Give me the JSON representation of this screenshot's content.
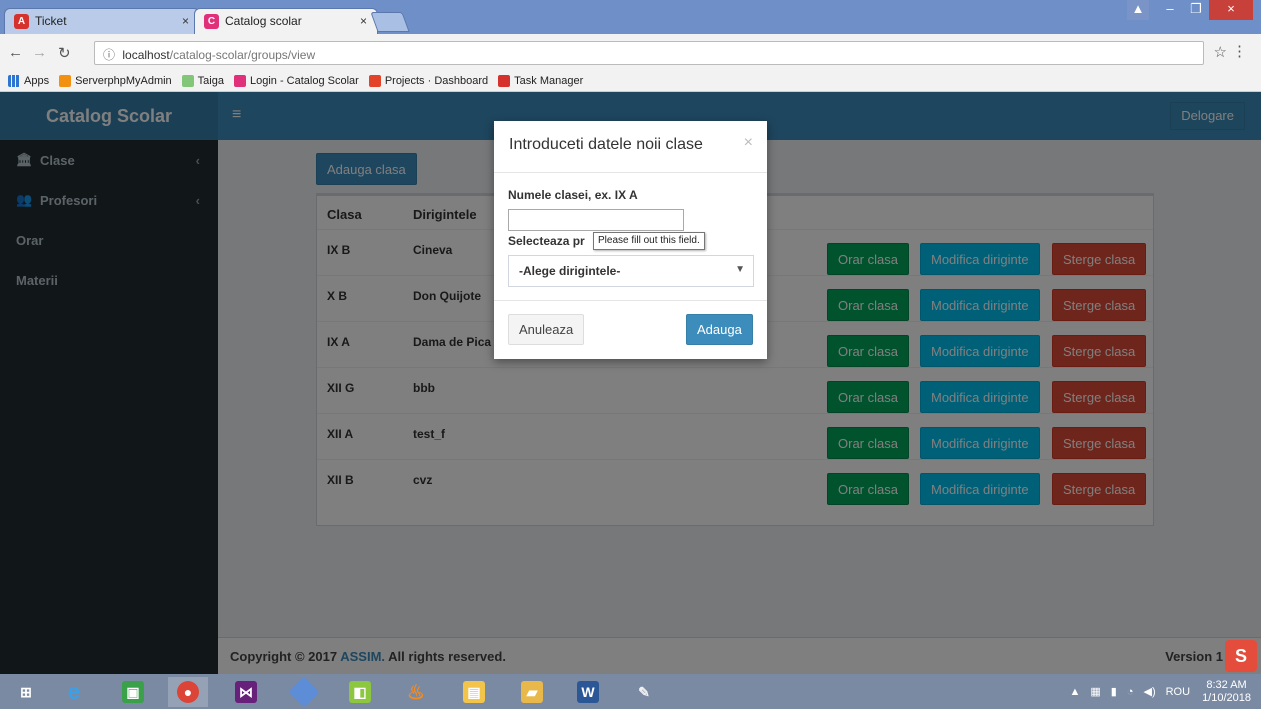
{
  "browser": {
    "tabs": [
      {
        "label": "Ticket",
        "icon": "angular-icon",
        "active": false
      },
      {
        "label": "Catalog scolar",
        "icon": "app-icon",
        "active": true
      }
    ],
    "url_host": "localhost",
    "url_path": "/catalog-scolar/groups/view",
    "bookmarks": [
      {
        "label": "Apps",
        "icon": "apps-grid-icon"
      },
      {
        "label": "ServerphpMyAdmin",
        "icon": "phpmyadmin-icon"
      },
      {
        "label": "Taiga",
        "icon": "taiga-icon"
      },
      {
        "label": "Login - Catalog Scolar",
        "icon": "app-icon"
      },
      {
        "label": "Projects · Dashboard",
        "icon": "gitlab-icon"
      },
      {
        "label": "Task Manager",
        "icon": "angular-icon"
      }
    ]
  },
  "app": {
    "brand": "Catalog Scolar",
    "logout_label": "Delogare",
    "sidebar": [
      {
        "label": "Clase",
        "icon": "bank-icon",
        "has_children": true
      },
      {
        "label": "Profesori",
        "icon": "users-icon",
        "has_children": true
      },
      {
        "label": "Orar",
        "icon": "",
        "has_children": false
      },
      {
        "label": "Materii",
        "icon": "",
        "has_children": false
      }
    ],
    "add_class_label": "Adauga clasa",
    "table": {
      "headers": [
        "Clasa",
        "Dirigintele"
      ],
      "rows": [
        {
          "clasa": "IX B",
          "diriginte": "Cineva"
        },
        {
          "clasa": "X B",
          "diriginte": "Don Quijote"
        },
        {
          "clasa": "IX A",
          "diriginte": "Dama de Pica"
        },
        {
          "clasa": "XII G",
          "diriginte": "bbb"
        },
        {
          "clasa": "XII A",
          "diriginte": "test_f"
        },
        {
          "clasa": "XII B",
          "diriginte": "cvz"
        }
      ],
      "row_actions": {
        "schedule": "Orar clasa",
        "edit": "Modifica diriginte",
        "delete": "Sterge clasa"
      }
    },
    "footer": {
      "prefix": "Copyright © 2017 ",
      "link": "ASSIM.",
      "suffix": " All rights reserved.",
      "version": "Version 1"
    }
  },
  "modal": {
    "title": "Introduceti datele noii clase",
    "close_glyph": "×",
    "name_label": "Numele clasei, ex. IX A",
    "name_value": "",
    "select_label": "Selecteaza pr",
    "validation_tooltip": "Please fill out this field.",
    "select_value": "-Alege dirigintele-",
    "cancel_label": "Anuleaza",
    "submit_label": "Adauga"
  },
  "taskbar": {
    "lang": "ROU",
    "time": "8:32 AM",
    "date": "1/10/2018"
  },
  "colors": {
    "primary": "#3c8dbc",
    "success": "#00a65a",
    "info": "#00c0ef",
    "danger": "#dd4b39",
    "sidebar": "#222d32"
  }
}
